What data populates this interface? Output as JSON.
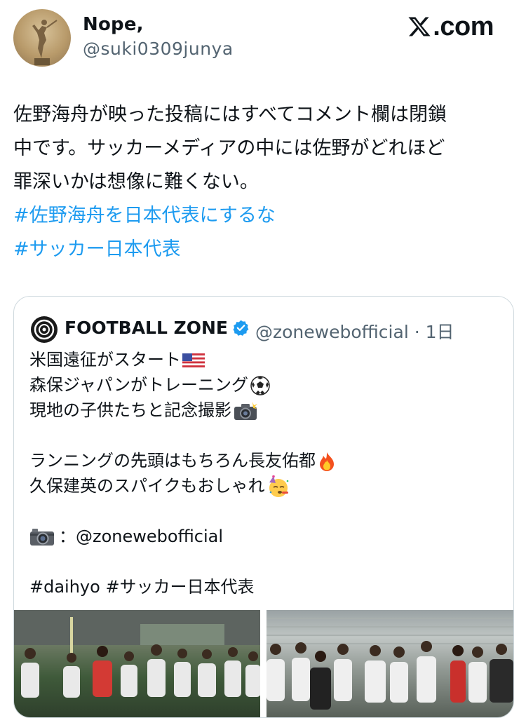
{
  "author": {
    "display_name": "Nope,",
    "handle": "@suki0309junya"
  },
  "brand": {
    "text": ".com",
    "icon": "x-logo-icon"
  },
  "post": {
    "lines": [
      "佐野海舟が映った投稿にはすべてコメント欄は閉鎖",
      "中です。サッカーメディアの中には佐野がどれほど",
      "罪深いかは想像に難くない。"
    ],
    "hashtags": [
      "#佐野海舟を日本代表にするな",
      "#サッカー日本代表"
    ]
  },
  "quote": {
    "name": "FOOTBALL ZONE",
    "handle": "@zonewebofficial",
    "separator": "·",
    "time": "1日",
    "lines": [
      "米国遠征がスタート",
      "森保ジャパンがトレーニング",
      "現地の子供たちと記念撮影",
      "",
      "ランニングの先頭はもちろん長友佑都",
      "久保建英のスパイクもおしゃれ",
      "",
      "：@zonewebofficial",
      "",
      "#daihyo #サッカー日本代表"
    ]
  },
  "colors": {
    "hashtag": "#1d9bf0",
    "secondary": "#536471",
    "verified": "#1d9bf0",
    "border": "#cfd9de"
  }
}
